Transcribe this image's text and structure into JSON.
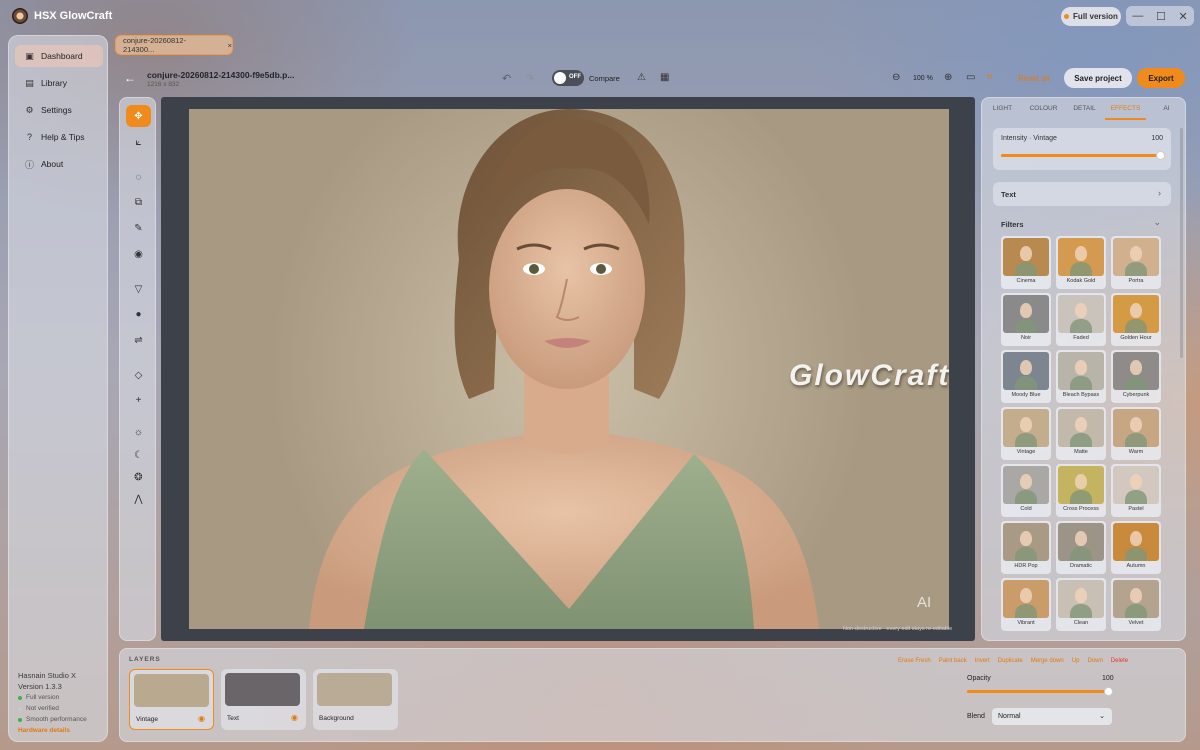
{
  "app": {
    "title": "HSX GlowCraft",
    "badge": "Full version"
  },
  "window_controls": [
    "—",
    "☐",
    "✕"
  ],
  "sidebar": {
    "items": [
      {
        "label": "Dashboard",
        "icon": "dashboard-icon",
        "glyph": "▣",
        "active": true
      },
      {
        "label": "Library",
        "icon": "library-icon",
        "glyph": "▤",
        "active": false
      },
      {
        "label": "Settings",
        "icon": "gear-icon",
        "glyph": "⚙",
        "active": false
      },
      {
        "label": "Help & Tips",
        "icon": "help-icon",
        "glyph": "?",
        "active": false
      },
      {
        "label": "About",
        "icon": "info-icon",
        "glyph": "ⓘ",
        "active": false
      }
    ],
    "studio": "Hasnain Studio X",
    "version": "Version 1.3.3",
    "status": [
      {
        "label": "Full version",
        "color": "#3cb34a"
      },
      {
        "label": "Not verified",
        "color": "#c9c9c9"
      },
      {
        "label": "Smooth performance",
        "color": "#3cb34a"
      }
    ],
    "hardware": "Hardware details"
  },
  "tab": {
    "label": "conjure-20260812-214300...",
    "close": "×"
  },
  "toolbar": {
    "back": "←",
    "filename": "conjure-20260812-214300-f9e5db.p...",
    "dimensions": "1216 x 832",
    "undo": "↶",
    "redo": "↷",
    "toggle": "OFF",
    "compare": "Compare",
    "warning": "⚠",
    "grid": "▦",
    "zoom_out": "⊖",
    "zoom": "100 %",
    "zoom_in": "⊕",
    "fit": "▭",
    "actual": "⌗",
    "reset": "Reset all",
    "save": "Save project",
    "export": "Export"
  },
  "tools": [
    {
      "name": "move-tool",
      "glyph": "✥",
      "active": true
    },
    {
      "name": "crop-tool",
      "glyph": "⟀"
    },
    {
      "name": "lasso-tool",
      "glyph": "◌"
    },
    {
      "name": "clone-tool",
      "glyph": "⧉"
    },
    {
      "name": "brush-tool",
      "glyph": "✎"
    },
    {
      "name": "eye-tool",
      "glyph": "◉"
    },
    {
      "name": "fill-tool",
      "glyph": "▽"
    },
    {
      "name": "circle-tool",
      "glyph": "●"
    },
    {
      "name": "adjust-tool",
      "glyph": "⇌"
    },
    {
      "name": "eraser-tool",
      "glyph": "◇"
    },
    {
      "name": "add-tool",
      "glyph": "+"
    },
    {
      "name": "light-tool",
      "glyph": "☼"
    },
    {
      "name": "moon-tool",
      "glyph": "☾"
    },
    {
      "name": "color-tool",
      "glyph": "❂"
    },
    {
      "name": "wave-tool",
      "glyph": "⋀"
    }
  ],
  "canvas": {
    "watermark": "GlowCraft",
    "ai": "AI",
    "note": "Non-destructive · every edit stays re-editable"
  },
  "right_panel": {
    "tabs": [
      {
        "label": "LIGHT",
        "active": false
      },
      {
        "label": "COLOUR",
        "active": false
      },
      {
        "label": "DETAIL",
        "active": false
      },
      {
        "label": "EFFECTS",
        "active": true
      },
      {
        "label": "AI",
        "active": false
      }
    ],
    "intensity": {
      "label": "Intensity · Vintage",
      "value": "100",
      "level": 1.0
    },
    "text_section": {
      "label": "Text",
      "chevron": "›"
    },
    "filters_section": {
      "label": "Filters",
      "chevron": "⌄"
    },
    "filters": [
      {
        "label": "Cinema",
        "color": "#b88a4f"
      },
      {
        "label": "Kodak Gold",
        "color": "#d39a50"
      },
      {
        "label": "Portra",
        "color": "#d0b08e"
      },
      {
        "label": "Noir",
        "color": "#8a8a8a"
      },
      {
        "label": "Faded",
        "color": "#c9c3bb"
      },
      {
        "label": "Golden Hour",
        "color": "#d49a44"
      },
      {
        "label": "Moody Blue",
        "color": "#7d8591"
      },
      {
        "label": "Bleach Bypass",
        "color": "#b9b4aa"
      },
      {
        "label": "Cyberpunk",
        "color": "#8e8b8a"
      },
      {
        "label": "Vintage",
        "color": "#c3ad8c"
      },
      {
        "label": "Matte",
        "color": "#c2b9aa"
      },
      {
        "label": "Warm",
        "color": "#c7a683"
      },
      {
        "label": "Cold",
        "color": "#a9a8a4"
      },
      {
        "label": "Cross Process",
        "color": "#c4b462"
      },
      {
        "label": "Pastel",
        "color": "#d2c8bf"
      },
      {
        "label": "HDR Pop",
        "color": "#a99a86"
      },
      {
        "label": "Dramatic",
        "color": "#9c9487"
      },
      {
        "label": "Autumn",
        "color": "#c98a3c"
      },
      {
        "label": "Vibrant",
        "color": "#c99c6a"
      },
      {
        "label": "Clean",
        "color": "#c8c0b4"
      },
      {
        "label": "Velvet",
        "color": "#b4a38f"
      }
    ]
  },
  "layers": {
    "title": "LAYERS",
    "items": [
      {
        "label": "Vintage",
        "active": true,
        "eye": "◉",
        "color": "#b9a98f"
      },
      {
        "label": "Text",
        "active": false,
        "eye": "◉",
        "color": "#6a6568"
      },
      {
        "label": "Background",
        "active": false,
        "eye": "",
        "color": "#b9ab95"
      }
    ],
    "actions": [
      "Erase Fresh",
      "Paint back",
      "Invert",
      "Duplicate",
      "Merge down",
      "Up",
      "Down",
      "Delete"
    ],
    "opacity": {
      "label": "Opacity",
      "value": "100",
      "level": 1.0
    },
    "blend": {
      "label": "Blend",
      "value": "Normal"
    }
  }
}
